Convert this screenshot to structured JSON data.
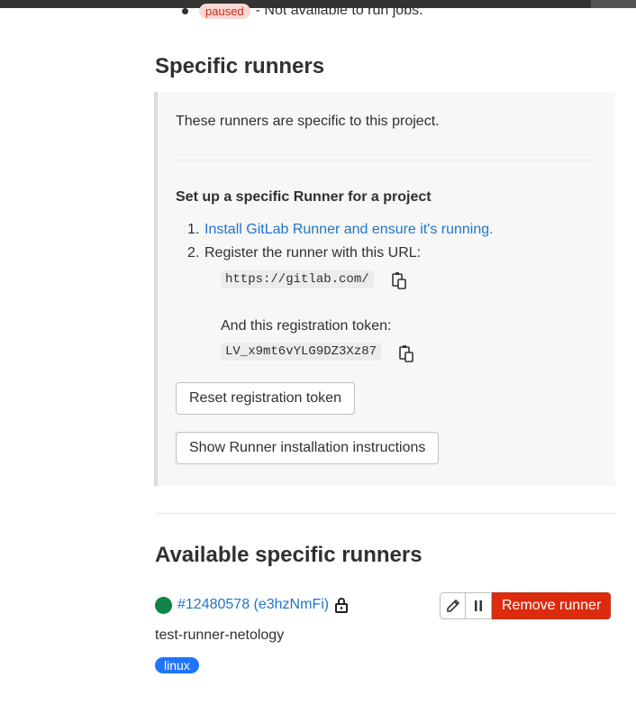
{
  "legend": {
    "badge": "paused",
    "text": "- Not available to run jobs."
  },
  "specific": {
    "title": "Specific runners",
    "intro": "These runners are specific to this project.",
    "setup_heading": "Set up a specific Runner for a project",
    "step1_num": "1.",
    "step1_link": "Install GitLab Runner and ensure it's running.",
    "step2_num": "2.",
    "step2_text": "Register the runner with this URL:",
    "url": "https://gitlab.com/",
    "token_label": "And this registration token:",
    "token": "LV_x9mt6vYLG9DZ3Xz87",
    "reset_button": "Reset registration token",
    "show_button": "Show Runner installation instructions"
  },
  "available": {
    "title": "Available specific runners",
    "runner": {
      "id_label": "#12480578 (e3hzNmFi)",
      "description": "test-runner-netology",
      "tag": "linux",
      "status_color": "#108548",
      "remove_button": "Remove runner"
    }
  },
  "icons": {
    "copy": "copy-to-clipboard-icon",
    "lock": "lock-icon",
    "edit": "pencil-icon",
    "pause": "pause-icon"
  },
  "colors": {
    "link": "#1f75cb",
    "danger": "#dd2b0e",
    "tag": "#1f75fe"
  }
}
